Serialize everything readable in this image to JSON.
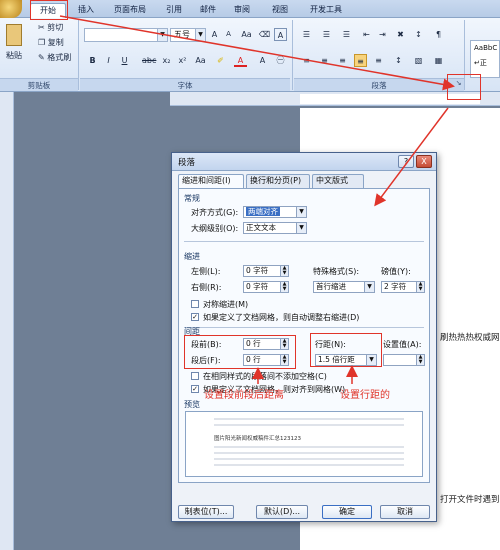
{
  "ribbon": {
    "tabs": [
      "开始",
      "插入",
      "页面布局",
      "引用",
      "邮件",
      "审阅",
      "视图",
      "开发工具"
    ],
    "clipboard": {
      "paste": "粘贴",
      "cut": "剪切",
      "copy": "复制",
      "format_painter": "格式刷",
      "group": "剪贴板"
    },
    "font": {
      "size": "五号",
      "group": "字体"
    },
    "paragraph": {
      "group": "段落"
    },
    "styles": {
      "preview": "AaBbC",
      "name": "↵正"
    }
  },
  "document": {
    "line1": "刷热热热权威网",
    "line2": "打开文件时遇到"
  },
  "dialog": {
    "title": "段落",
    "help": "?",
    "close": "X",
    "tabs": [
      "缩进和间距(I)",
      "换行和分页(P)",
      "中文版式(H)"
    ],
    "general": {
      "title": "常规",
      "align_label": "对齐方式(G):",
      "align_value": "两端对齐",
      "outline_label": "大纲级别(O):",
      "outline_value": "正文文本"
    },
    "indent": {
      "title": "缩进",
      "left_label": "左侧(L):",
      "left_value": "0 字符",
      "right_label": "右侧(R):",
      "right_value": "0 字符",
      "special_label": "特殊格式(S):",
      "special_value": "首行缩进",
      "by_label": "磅值(Y):",
      "by_value": "2 字符",
      "mirror": "对称缩进(M)",
      "auto_adjust": "如果定义了文档网格，则自动调整右缩进(D)"
    },
    "spacing": {
      "title": "间距",
      "before_label": "段前(B):",
      "before_value": "0 行",
      "after_label": "段后(F):",
      "after_value": "0 行",
      "line_label": "行距(N):",
      "line_value": "1.5 倍行距",
      "at_label": "设置值(A):",
      "no_space": "在相同样式的段落间不添加空格(C)",
      "snap_grid": "如果定义了文档网格，则对齐到网格(W)"
    },
    "preview": {
      "title": "预览",
      "sample_text": "图片阳光新闻权威稿件汇总123123"
    },
    "buttons": {
      "tabs": "制表位(T)...",
      "default": "默认(D)...",
      "ok": "确定",
      "cancel": "取消"
    }
  },
  "annotations": {
    "spacing_note": "设置段前段后距离",
    "line_note": "设置行距的"
  },
  "colors": {
    "annotation": "#e0342a",
    "dialog_title": "#c2d4ee",
    "ribbon": "#d7e4f5"
  }
}
